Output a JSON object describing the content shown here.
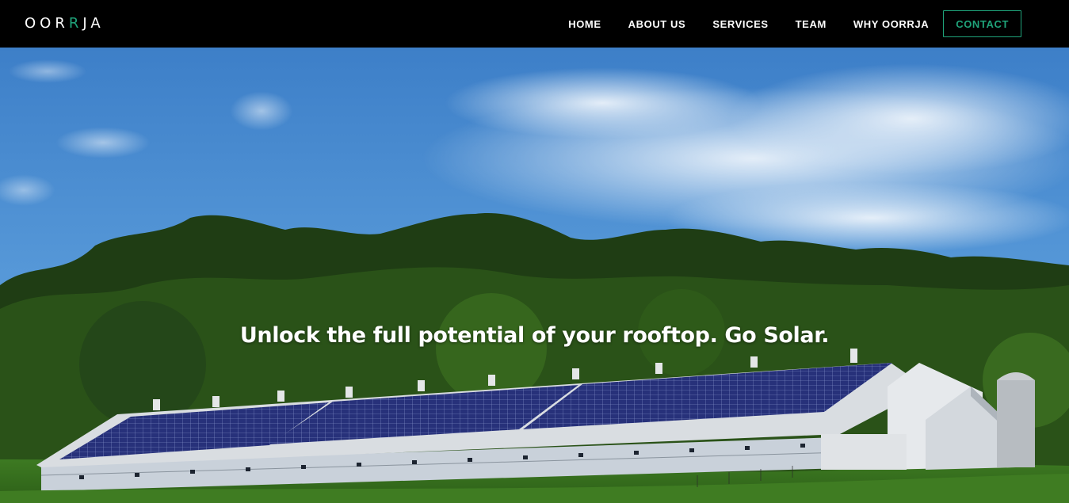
{
  "brand": {
    "logo_prefix": "OOR",
    "logo_accent": "R",
    "logo_suffix": "JA",
    "accent_color": "#1fa37a"
  },
  "nav": {
    "items": [
      "HOME",
      "ABOUT US",
      "SERVICES",
      "TEAM",
      "WHY OORRJA"
    ],
    "contact_label": "CONTACT"
  },
  "hero": {
    "headline": "Unlock the full potential of your rooftop. Go Solar."
  }
}
